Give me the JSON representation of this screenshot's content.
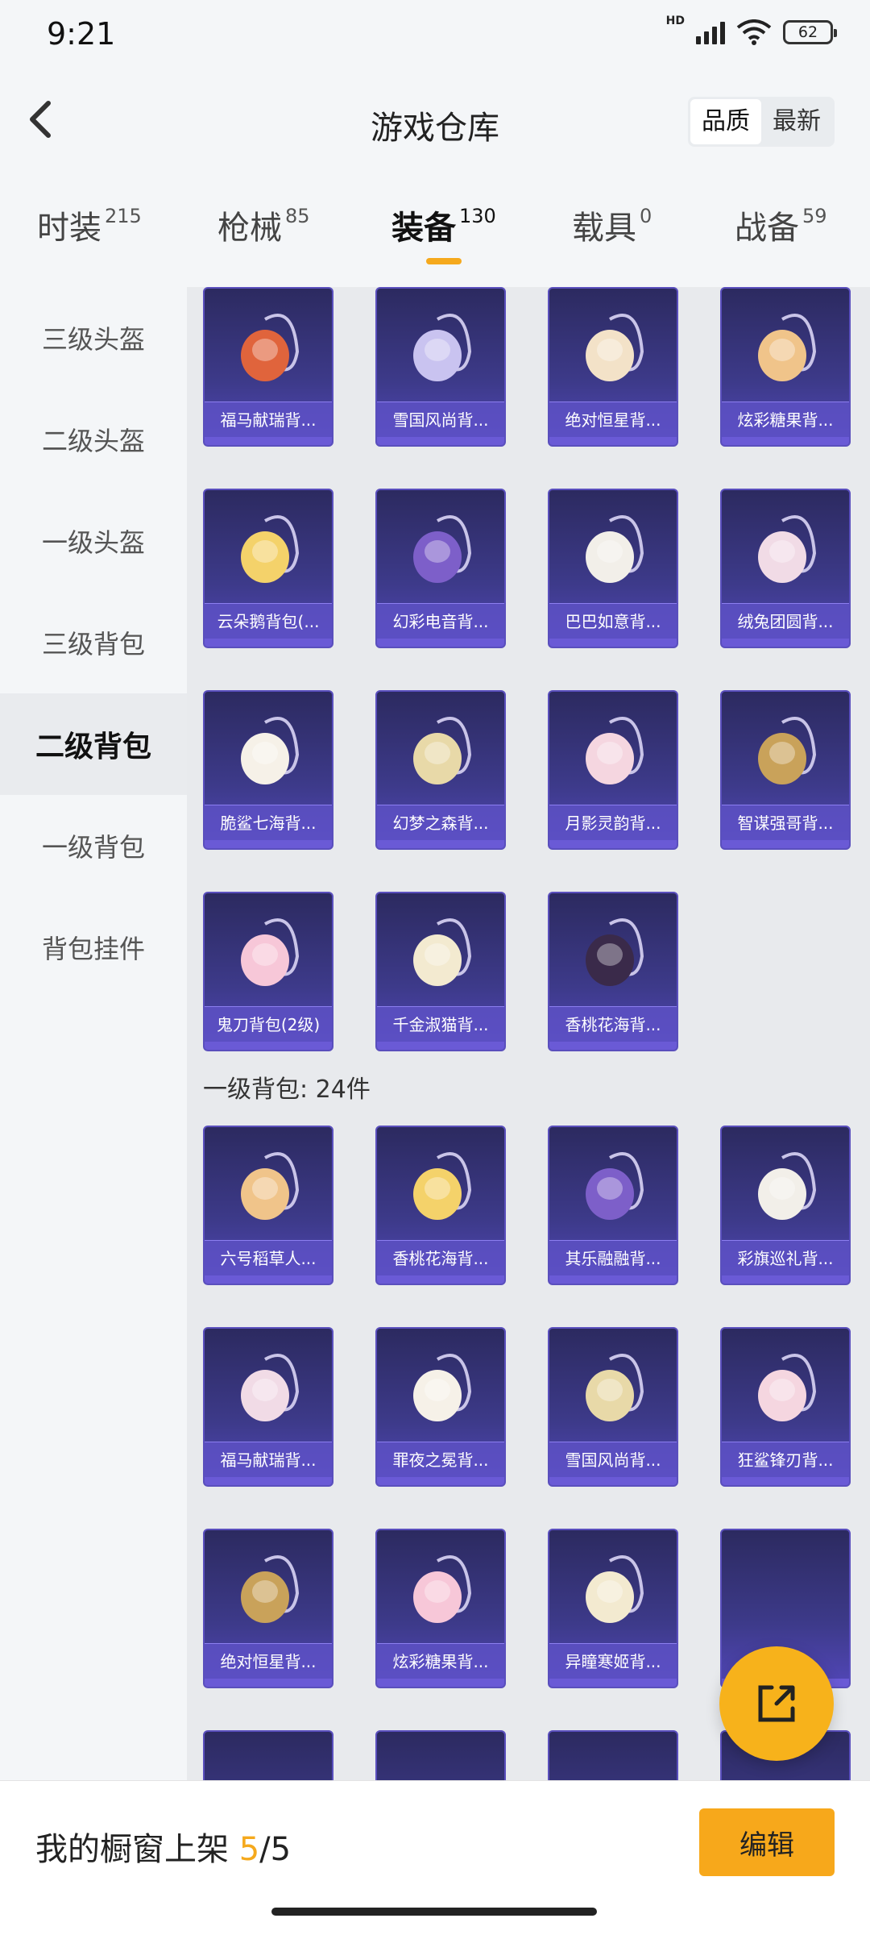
{
  "status": {
    "time": "9:21",
    "hd": "HD",
    "battery": "62"
  },
  "header": {
    "title": "游戏仓库",
    "sort_options": [
      "品质",
      "最新"
    ],
    "sort_active": "品质"
  },
  "tabs": [
    {
      "label": "时装",
      "count": "215"
    },
    {
      "label": "枪械",
      "count": "85"
    },
    {
      "label": "装备",
      "count": "130"
    },
    {
      "label": "载具",
      "count": "0"
    },
    {
      "label": "战备",
      "count": "59"
    }
  ],
  "sidebar": [
    "三级头盔",
    "二级头盔",
    "一级头盔",
    "三级背包",
    "二级背包",
    "一级背包",
    "背包挂件"
  ],
  "sidebar_active": "二级背包",
  "level2_items": [
    "福马献瑞背...",
    "雪国风尚背...",
    "绝对恒星背...",
    "炫彩糖果背...",
    "云朵鹅背包(...",
    "幻彩电音背...",
    "巴巴如意背...",
    "绒兔团圆背...",
    "脆鲨七海背...",
    "幻梦之森背...",
    "月影灵韵背...",
    "智谋强哥背...",
    "鬼刀背包(2级)",
    "千金淑猫背...",
    "香桃花海背..."
  ],
  "level1_section": "一级背包: 24件",
  "level1_items": [
    "六号稻草人...",
    "香桃花海背...",
    "其乐融融背...",
    "彩旗巡礼背...",
    "福马献瑞背...",
    "罪夜之冕背...",
    "雪国风尚背...",
    "狂鲨锋刃背...",
    "绝对恒星背...",
    "炫彩糖果背...",
    "异瞳寒姬背...",
    "",
    "",
    "",
    "",
    ""
  ],
  "bottom": {
    "showcase_label": "我的橱窗上架",
    "showcase_count": "5",
    "showcase_total": "/5",
    "edit_label": "编辑"
  },
  "colors": {
    "accent": "#f7a81b",
    "card": "#3d3a8a"
  }
}
